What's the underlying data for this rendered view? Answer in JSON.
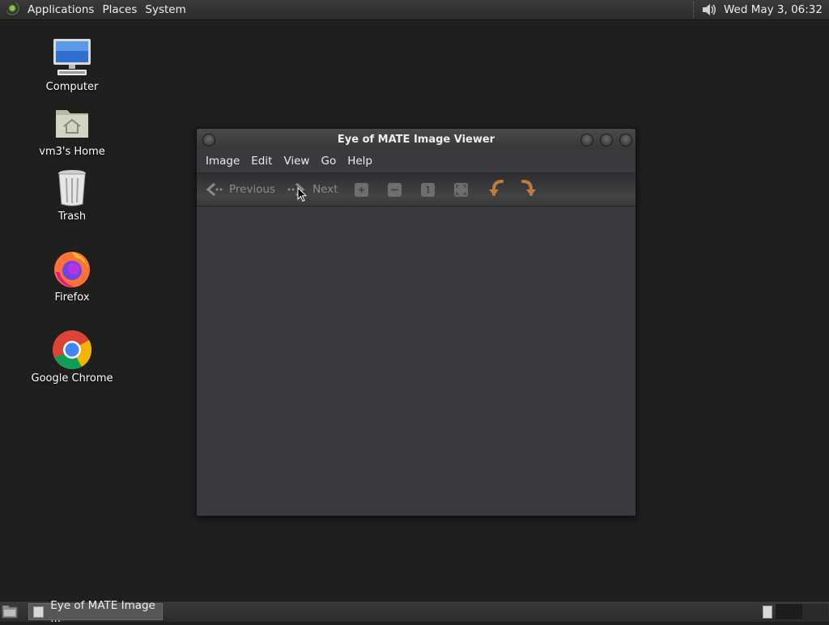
{
  "top_panel": {
    "menus": [
      "Applications",
      "Places",
      "System"
    ],
    "clock": "Wed May  3, 06:32"
  },
  "desktop_icons": [
    {
      "label": "Computer",
      "icon": "computer-icon"
    },
    {
      "label": "vm3's Home",
      "icon": "home-folder-icon"
    },
    {
      "label": "Trash",
      "icon": "trash-icon"
    },
    {
      "label": "Firefox",
      "icon": "firefox-icon"
    },
    {
      "label": "Google Chrome",
      "icon": "chrome-icon"
    }
  ],
  "window": {
    "title": "Eye of MATE Image Viewer",
    "menus": [
      "Image",
      "Edit",
      "View",
      "Go",
      "Help"
    ],
    "toolbar": {
      "previous": "Previous",
      "next": "Next",
      "icons": [
        "zoom-in-icon",
        "zoom-out-icon",
        "zoom-normal-icon",
        "zoom-fit-icon",
        "rotate-left-icon",
        "rotate-right-icon"
      ]
    }
  },
  "taskbar": {
    "tasks": [
      {
        "label": "Eye of MATE Image ..."
      }
    ]
  }
}
